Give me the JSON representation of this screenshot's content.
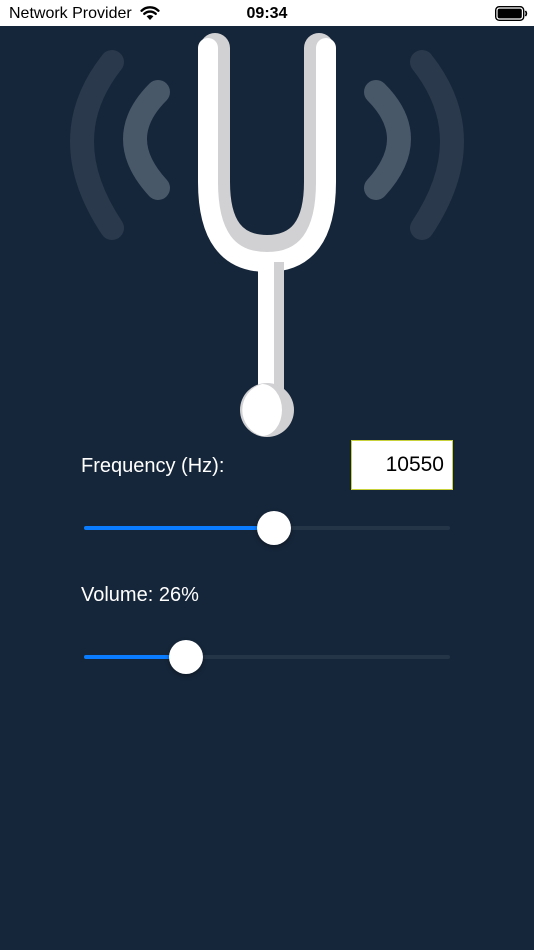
{
  "status_bar": {
    "carrier": "Network Provider",
    "time": "09:34",
    "wifi_icon": "wifi-icon",
    "battery_icon": "battery-icon"
  },
  "hero": {
    "icon": "tuning-fork-icon",
    "waves_icon": "sound-waves-icon"
  },
  "frequency": {
    "label": "Frequency (Hz):",
    "value": "10550",
    "slider_fraction": 0.52
  },
  "volume": {
    "label": "Volume: 26%",
    "slider_fraction": 0.28
  },
  "colors": {
    "background": "#16263a",
    "accent": "#0a7cff",
    "track": "#243548",
    "input_border": "#c8d13a"
  }
}
